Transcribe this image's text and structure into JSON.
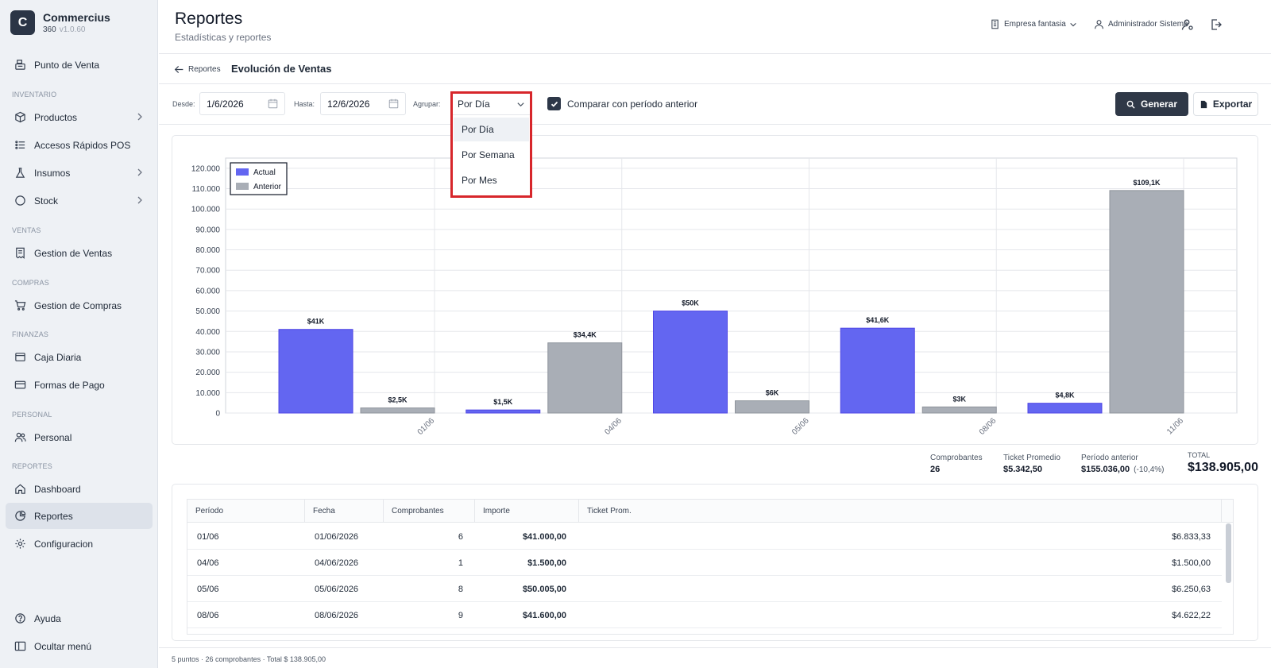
{
  "sidebar": {
    "brand_initial": "C",
    "brand_name": "Commercius",
    "brand_product": "360",
    "brand_version": "v1.0.60",
    "sections": {
      "inventario": "INVENTARIO",
      "ventas": "VENTAS",
      "compras": "COMPRAS",
      "finanzas": "FINANZAS",
      "personal": "PERSONAL",
      "reportes": "REPORTES"
    },
    "items": {
      "pos": "Punto de Venta",
      "productos": "Productos",
      "accesos": "Accesos Rápidos POS",
      "insumos": "Insumos",
      "stock": "Stock",
      "gestion_ventas": "Gestion de Ventas",
      "gestion_compras": "Gestion de Compras",
      "caja": "Caja Diaria",
      "formas_pago": "Formas de Pago",
      "personal": "Personal",
      "dashboard": "Dashboard",
      "reportes": "Reportes",
      "configuracion": "Configuracion",
      "ayuda": "Ayuda",
      "ocultar": "Ocultar menú"
    }
  },
  "header": {
    "title": "Reportes",
    "subtitle": "Estadísticas y reportes",
    "company": "Empresa fantasia",
    "user": "Administrador Sistema"
  },
  "breadcrumb": {
    "back": "Reportes",
    "title": "Evolución de Ventas"
  },
  "filters": {
    "desde_label": "Desde:",
    "desde_value": "1/6/2026",
    "hasta_label": "Hasta:",
    "hasta_value": "12/6/2026",
    "agrupar_label": "Agrupar:",
    "agrupar_value": "Por Día",
    "compare_label": "Comparar con período anterior",
    "generar": "Generar",
    "exportar": "Exportar"
  },
  "dropdown": {
    "options": [
      "Por Día",
      "Por Semana",
      "Por Mes"
    ],
    "highlighted": 0
  },
  "chart_data": {
    "type": "bar",
    "categories": [
      "01/06",
      "04/06",
      "05/06",
      "08/06",
      "11/06"
    ],
    "series": [
      {
        "name": "Actual",
        "color": "#6366f1",
        "values": [
          41000,
          1500,
          50005,
          41600,
          4800
        ],
        "labels": [
          "$41K",
          "$1,5K",
          "$50K",
          "$41,6K",
          "$4,8K"
        ]
      },
      {
        "name": "Anterior",
        "color": "#a9aeb6",
        "values": [
          2500,
          34400,
          6000,
          3000,
          109100
        ],
        "labels": [
          "$2,5K",
          "$34,4K",
          "$6K",
          "$3K",
          "$109,1K"
        ]
      }
    ],
    "yticks": [
      "0",
      "10.000",
      "20.000",
      "30.000",
      "40.000",
      "50.000",
      "60.000",
      "70.000",
      "80.000",
      "90.000",
      "100.000",
      "110.000",
      "120.000"
    ],
    "ylim": [
      0,
      125000
    ],
    "legend_position": "top-left",
    "grid": true
  },
  "summary": {
    "comprobantes_label": "Comprobantes",
    "comprobantes_value": "26",
    "ticket_label": "Ticket Promedio",
    "ticket_value": "$5.342,50",
    "anterior_label": "Período anterior",
    "anterior_value": "$155.036,00",
    "anterior_pct": "(-10,4%)",
    "total_label": "TOTAL",
    "total_value": "$138.905,00"
  },
  "table": {
    "headers": [
      "Período",
      "Fecha",
      "Comprobantes",
      "Importe",
      "Ticket Prom."
    ],
    "rows": [
      {
        "periodo": "01/06",
        "fecha": "01/06/2026",
        "comprobantes": "6",
        "importe": "$41.000,00",
        "ticket": "$6.833,33"
      },
      {
        "periodo": "04/06",
        "fecha": "04/06/2026",
        "comprobantes": "1",
        "importe": "$1.500,00",
        "ticket": "$1.500,00"
      },
      {
        "periodo": "05/06",
        "fecha": "05/06/2026",
        "comprobantes": "8",
        "importe": "$50.005,00",
        "ticket": "$6.250,63"
      },
      {
        "periodo": "08/06",
        "fecha": "08/06/2026",
        "comprobantes": "9",
        "importe": "$41.600,00",
        "ticket": "$4.622,22"
      }
    ]
  },
  "footer": {
    "text": "5 puntos · 26 comprobantes · Total $ 138.905,00"
  }
}
